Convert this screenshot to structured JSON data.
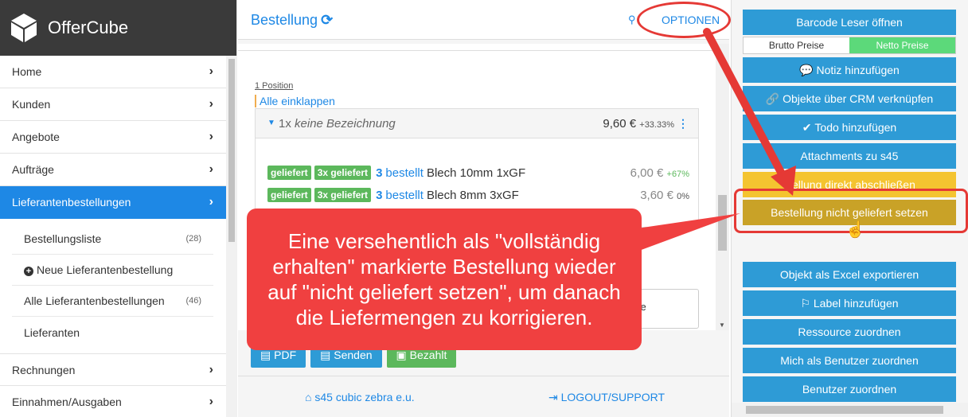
{
  "brand": {
    "name": "OfferCube"
  },
  "sidebar": {
    "items": [
      {
        "label": "Home"
      },
      {
        "label": "Kunden"
      },
      {
        "label": "Angebote"
      },
      {
        "label": "Aufträge"
      },
      {
        "label": "Lieferantenbestellungen"
      }
    ],
    "subitems": [
      {
        "label": "Bestellungsliste",
        "badge": "(28)"
      },
      {
        "label": "Neue Lieferantenbestellung",
        "badge": ""
      },
      {
        "label": "Alle Lieferantenbestellungen",
        "badge": "(46)"
      },
      {
        "label": "Lieferanten",
        "badge": ""
      }
    ],
    "bottom_items": [
      {
        "label": "Rechnungen"
      },
      {
        "label": "Einnahmen/Ausgaben"
      }
    ]
  },
  "header": {
    "title": "Bestellung",
    "options": "OPTIONEN"
  },
  "content": {
    "positions_label": "1 Position",
    "collapse_all": "Alle einklappen",
    "card": {
      "qty_prefix": "1x",
      "title": "keine Bezeichnung",
      "price": "9,60 €",
      "margin": "+33.33%"
    },
    "lines": [
      {
        "status": "geliefert",
        "delivered": "3x geliefert",
        "qty": "3",
        "ordered": "bestellt",
        "name": "Blech 10mm 1xGF",
        "price": "6,00 €",
        "margin": "+67%"
      },
      {
        "status": "geliefert",
        "delivered": "3x geliefert",
        "qty": "3",
        "ordered": "bestellt",
        "name": "Blech 8mm 3xGF",
        "price": "3,60 €",
        "margin": "0%"
      }
    ],
    "partial_box": "ce"
  },
  "bottom_buttons": {
    "pdf": "PDF",
    "send": "Senden",
    "paid": "Bezahlt"
  },
  "footer": {
    "company": "s45 cubic zebra e.u.",
    "logout": "LOGOUT/SUPPORT"
  },
  "actions": {
    "barcode": "Barcode Leser öffnen",
    "gross": "Brutto Preise",
    "net": "Netto Preise",
    "note": "Notiz hinzufügen",
    "crm": "Objekte über CRM verknüpfen",
    "todo": "Todo hinzufügen",
    "attachments": "Attachments zu s45",
    "close_direct": "stellung direkt abschließen",
    "not_delivered": "Bestellung nicht geliefert setzen",
    "excel": "Objekt als Excel exportieren",
    "label": "Label hinzufügen",
    "resource": "Ressource zuordnen",
    "assign_me": "Mich als Benutzer zuordnen",
    "assign_user": "Benutzer zuordnen"
  },
  "callout": {
    "text": "Eine versehentlich als \"vollständig erhalten\" markierte Bestellung wieder auf \"nicht geliefert setzen\", um danach die Liefermengen zu korrigieren."
  },
  "colors": {
    "primary": "#1e88e5",
    "action": "#2e9bd6",
    "success": "#5cb85c",
    "warning": "#f4c430",
    "olive": "#c9a227",
    "annotation": "#e53935"
  },
  "icons": [
    "cube-icon",
    "chevron-right-icon",
    "refresh-icon",
    "search-icon",
    "comment-icon",
    "link-icon",
    "check-icon",
    "flag-icon",
    "home-icon",
    "logout-icon",
    "file-pdf-icon",
    "send-icon",
    "money-icon",
    "plus-circle-icon",
    "cursor-hand-icon"
  ]
}
